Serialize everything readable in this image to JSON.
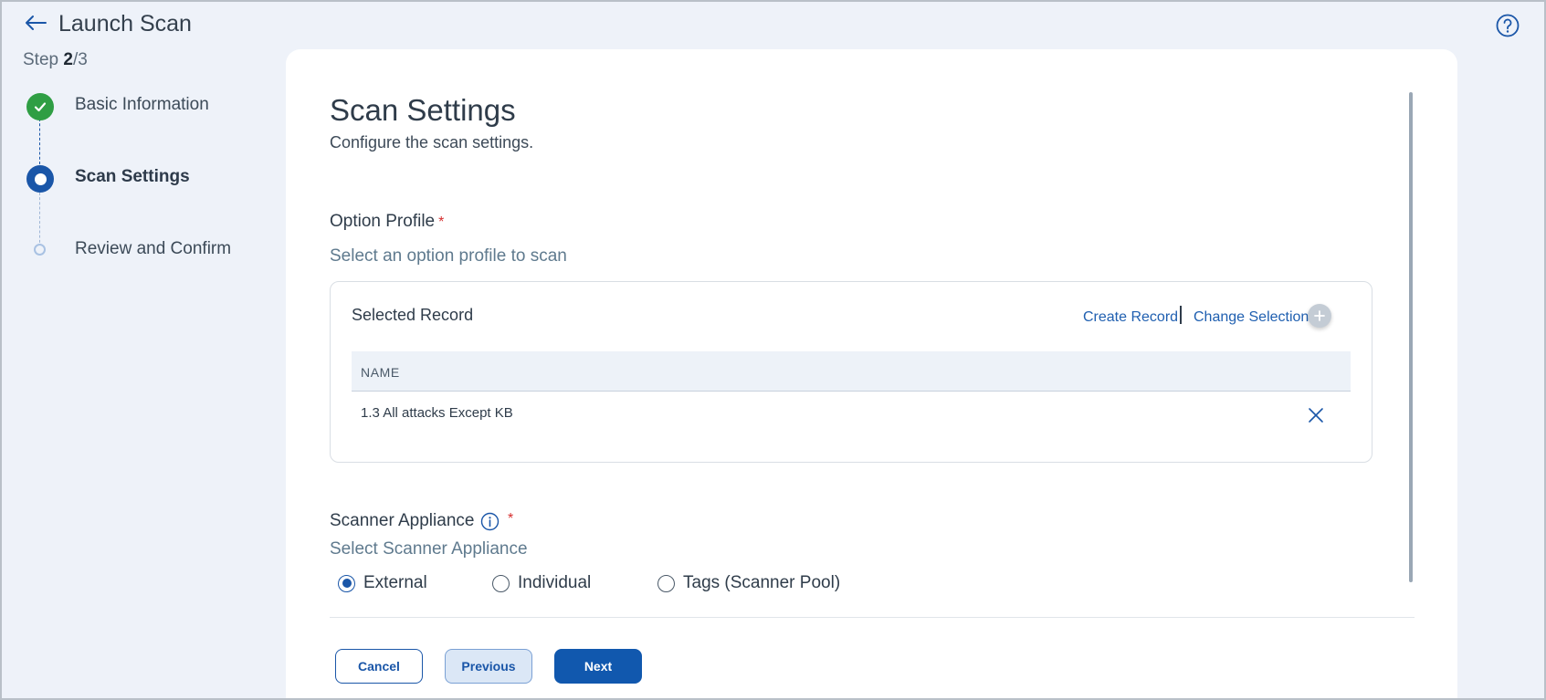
{
  "header": {
    "title": "Launch Scan",
    "step_prefix": "Step ",
    "step_current": "2",
    "step_total": "/3"
  },
  "stepper": {
    "steps": [
      {
        "label": "Basic Information",
        "state": "done"
      },
      {
        "label": "Scan Settings",
        "state": "current"
      },
      {
        "label": "Review and Confirm",
        "state": "todo"
      }
    ]
  },
  "section": {
    "title": "Scan Settings",
    "subtitle": "Configure the scan settings."
  },
  "option_profile": {
    "label": "Option Profile",
    "required_mark": "*",
    "hint": "Select an option profile to scan",
    "record_title": "Selected Record",
    "create_link": "Create Record",
    "change_link": "Change Selection",
    "table": {
      "columns": [
        "NAME"
      ],
      "rows": [
        [
          "1.3 All attacks Except KB"
        ]
      ]
    }
  },
  "scanner_appliance": {
    "label": "Scanner Appliance",
    "required_mark": "*",
    "hint": "Select Scanner Appliance",
    "options": [
      {
        "label": "External",
        "checked": true
      },
      {
        "label": "Individual",
        "checked": false
      },
      {
        "label": "Tags (Scanner Pool)",
        "checked": false
      }
    ]
  },
  "footer": {
    "cancel_label": "Cancel",
    "previous_label": "Previous",
    "next_label": "Next"
  },
  "icons": {
    "back": "arrow-left-icon",
    "help": "question-circle-icon",
    "info": "info-icon",
    "add": "plus-icon",
    "remove": "close-icon",
    "step_done": "check-icon"
  },
  "colors": {
    "accent": "#1a56a8",
    "success": "#2f9e44",
    "required": "#d62f2f",
    "page_bg": "#eef2f9"
  }
}
